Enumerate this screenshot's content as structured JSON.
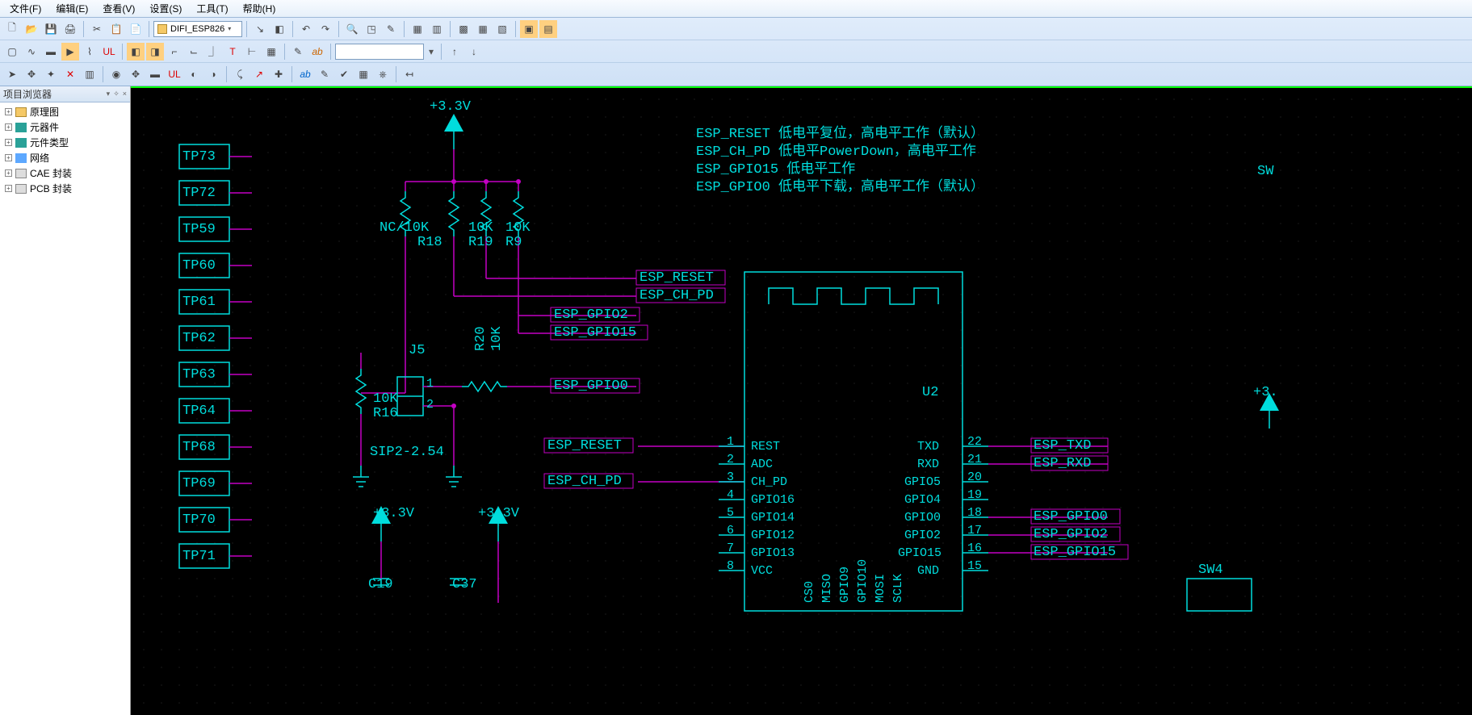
{
  "menu": {
    "file": "文件(F)",
    "edit": "编辑(E)",
    "view": "查看(V)",
    "settings": "设置(S)",
    "tools": "工具(T)",
    "help": "帮助(H)"
  },
  "toolbar": {
    "sheet_combo": "DIFI_ESP826",
    "arrow_down": "v"
  },
  "sidebar": {
    "title": "项目浏览器",
    "dock": "▼",
    "pin": "📌",
    "close": "×",
    "items": [
      {
        "label": "原理图",
        "icon": "ic-folder"
      },
      {
        "label": "元器件",
        "icon": "ic-teal"
      },
      {
        "label": "元件类型",
        "icon": "ic-teal"
      },
      {
        "label": "网络",
        "icon": "ic-net"
      },
      {
        "label": "CAE 封装",
        "icon": "ic-chip"
      },
      {
        "label": "PCB 封装",
        "icon": "ic-chip"
      }
    ]
  },
  "schematic": {
    "power1": "+3.3V",
    "power2": "+3.3V",
    "power3": "+3.3V",
    "power4": "+3.",
    "notes": [
      "ESP_RESET 低电平复位，高电平工作（默认）",
      "ESP_CH_PD 低电平PowerDown，高电平工作",
      "ESP_GPIO15 低电平工作",
      "ESP_GPIO0 低电平下载，高电平工作（默认）"
    ],
    "tp": [
      "TP73",
      "TP72",
      "TP59",
      "TP60",
      "TP61",
      "TP62",
      "TP63",
      "TP64",
      "TP68",
      "TP69",
      "TP70",
      "TP71"
    ],
    "r18": "NC/10K",
    "r18b": "R18",
    "r19": "10K",
    "r19b": "R19",
    "r9": "10K",
    "r9b": "R9",
    "r20": "R20",
    "r20v": "10K",
    "r16": "R16",
    "r16v": "10K",
    "j5": "J5",
    "j5p1": "1",
    "j5p2": "2",
    "j5ft": "SIP2-2.54",
    "c19": "C19",
    "c37": "C37",
    "u2": "U2",
    "sw4": "SW4",
    "sw_cut": "SW",
    "net_reset": "ESP_RESET",
    "net_chpd": "ESP_CH_PD",
    "net_gpio2": "ESP_GPIO2",
    "net_gpio15": "ESP_GPIO15",
    "net_gpio0": "ESP_GPIO0",
    "net_txd": "ESP_TXD",
    "net_rxd": "ESP_RXD",
    "net_r_gpio0": "ESP_GPIO0",
    "net_r_gpio2": "ESP_GPIO2",
    "net_r_gpio15": "ESP_GPIO15",
    "u2_left_pins": [
      "1",
      "2",
      "3",
      "4",
      "5",
      "6",
      "7",
      "8"
    ],
    "u2_left_labels": [
      "REST",
      "ADC",
      "CH_PD",
      "GPIO16",
      "GPIO14",
      "GPIO12",
      "GPIO13",
      "VCC"
    ],
    "u2_right_pins": [
      "22",
      "21",
      "20",
      "19",
      "18",
      "17",
      "16",
      "15"
    ],
    "u2_right_labels": [
      "TXD",
      "RXD",
      "GPIO5",
      "GPIO4",
      "GPIO0",
      "GPIO2",
      "GPIO15",
      "GND"
    ],
    "u2_bot_labels": [
      "CS0",
      "MISO",
      "GPIO9",
      "GPIO10",
      "MOSI",
      "SCLK"
    ]
  }
}
